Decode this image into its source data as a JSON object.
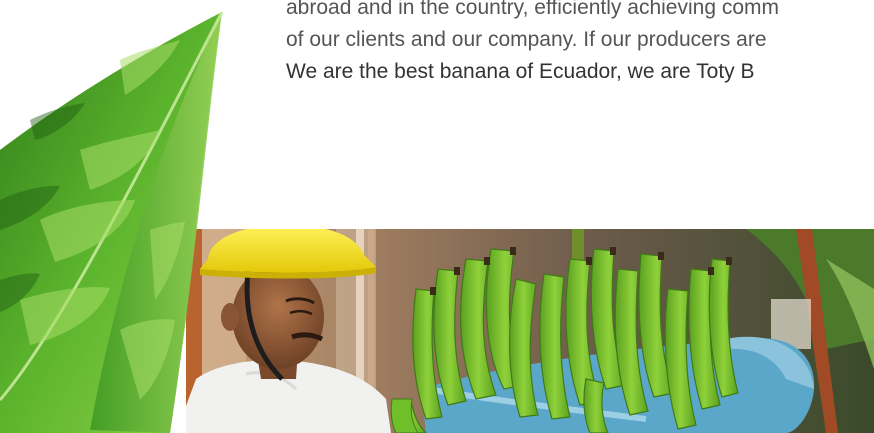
{
  "content": {
    "paragraph_lines": [
      "abroad and in the country, efficiently achieving comm",
      "of our clients and our company. If our producers are",
      "We are the best banana of Ecuador, we are Toty B"
    ]
  },
  "photo": {
    "subject": "worker-with-banana-bunch",
    "colors": {
      "banana_green": "#7cc02a",
      "helmet_yellow": "#f4e01f",
      "leaf_green": "#4f9a22",
      "bag_blue": "#5aa7c9"
    }
  },
  "decor": {
    "icon": "banana-leaf-icon"
  }
}
